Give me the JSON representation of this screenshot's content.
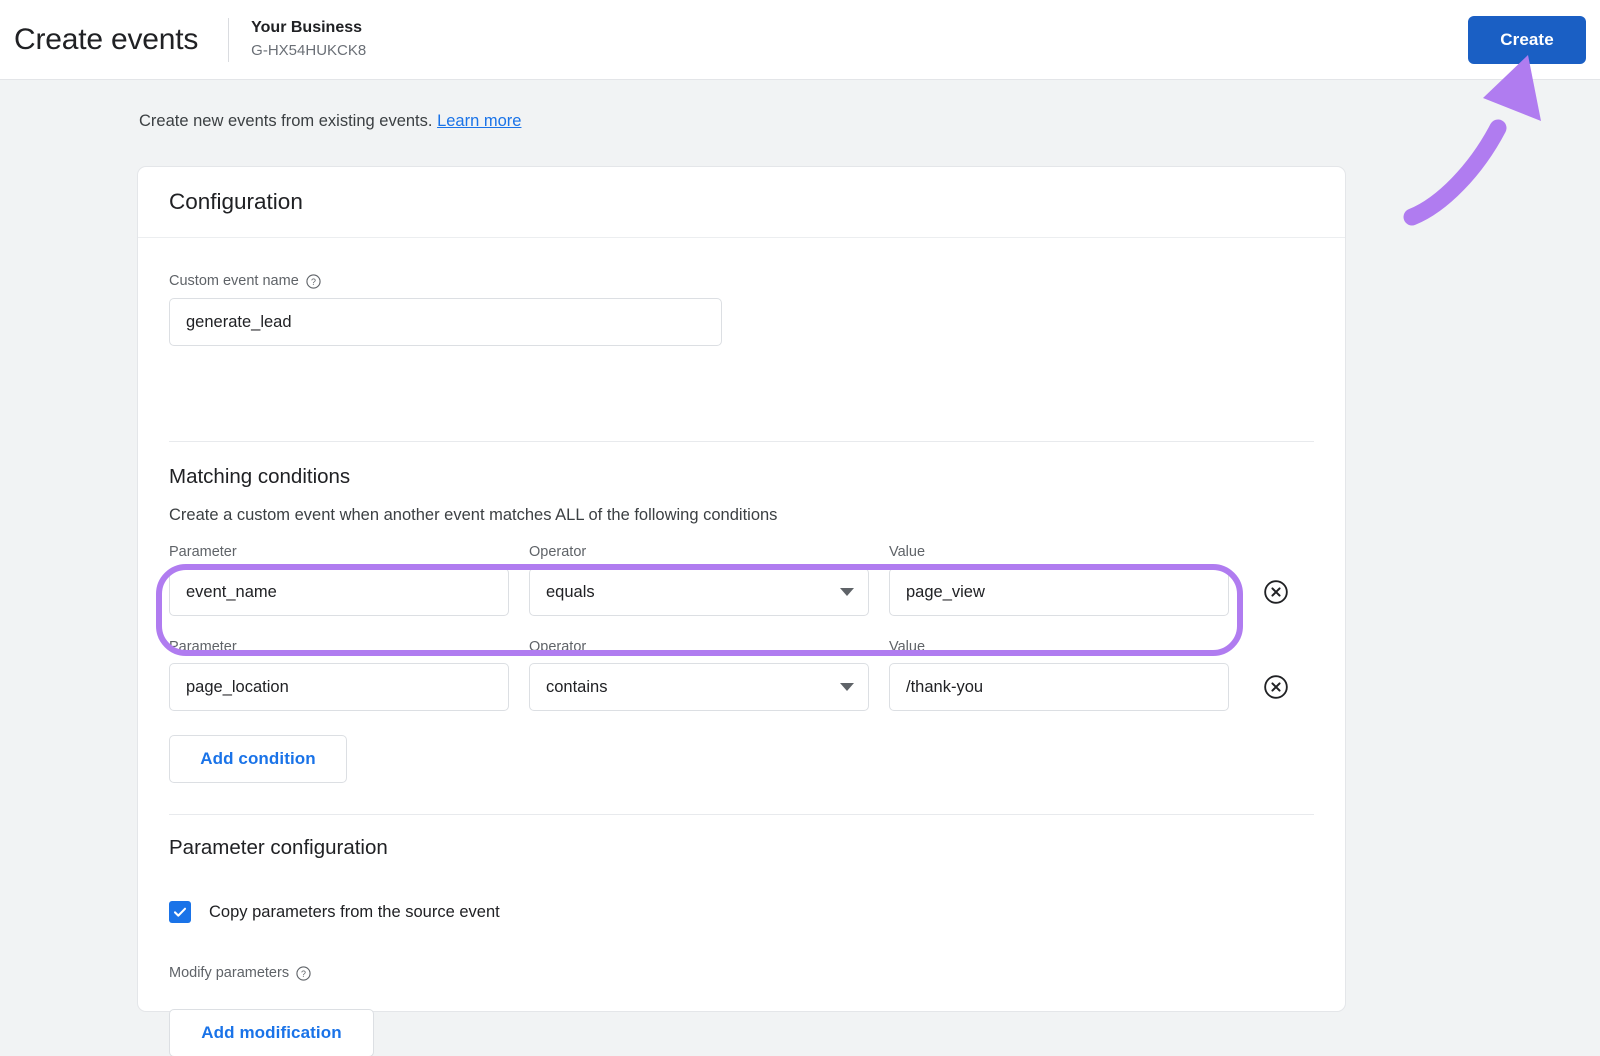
{
  "appbar": {
    "title": "Create events",
    "property_name": "Your Business",
    "property_id": "G-HX54HUKCK8",
    "create_label": "Create",
    "create_color": "#1a5fc4"
  },
  "intro": {
    "text": "Create new events from existing events.",
    "link_label": "Learn more"
  },
  "card": {
    "title": "Configuration",
    "custom_event": {
      "label": "Custom event name",
      "help_icon": "help-circle-icon",
      "value": "generate_lead",
      "placeholder": "Custom event name"
    },
    "matching": {
      "title": "Matching conditions",
      "description": "Create a custom event when another event matches ALL of the following conditions",
      "columns": {
        "parameter": "Parameter",
        "operator": "Operator",
        "value": "Value"
      },
      "conditions": [
        {
          "parameter": "event_name",
          "operator": "equals",
          "value": "page_view",
          "remove_icon": "remove-circle-x-icon",
          "highlighted": false
        },
        {
          "parameter": "page_location",
          "operator": "contains",
          "value": "/thank-you",
          "remove_icon": "remove-circle-x-icon",
          "highlighted": true
        }
      ],
      "add_condition_label": "Add condition"
    },
    "parameter_config": {
      "title": "Parameter configuration",
      "copy_checkbox_label": "Copy parameters from the source event",
      "copy_checkbox_checked": "true",
      "modify_label": "Modify parameters",
      "modify_help_icon": "help-circle-icon",
      "add_modification_label": "Add modification"
    }
  },
  "annotation": {
    "arrow_icon": "curved-arrow-up-right-icon",
    "arrow_color": "#b07cf0",
    "highlight_color": "#b07cf0"
  }
}
